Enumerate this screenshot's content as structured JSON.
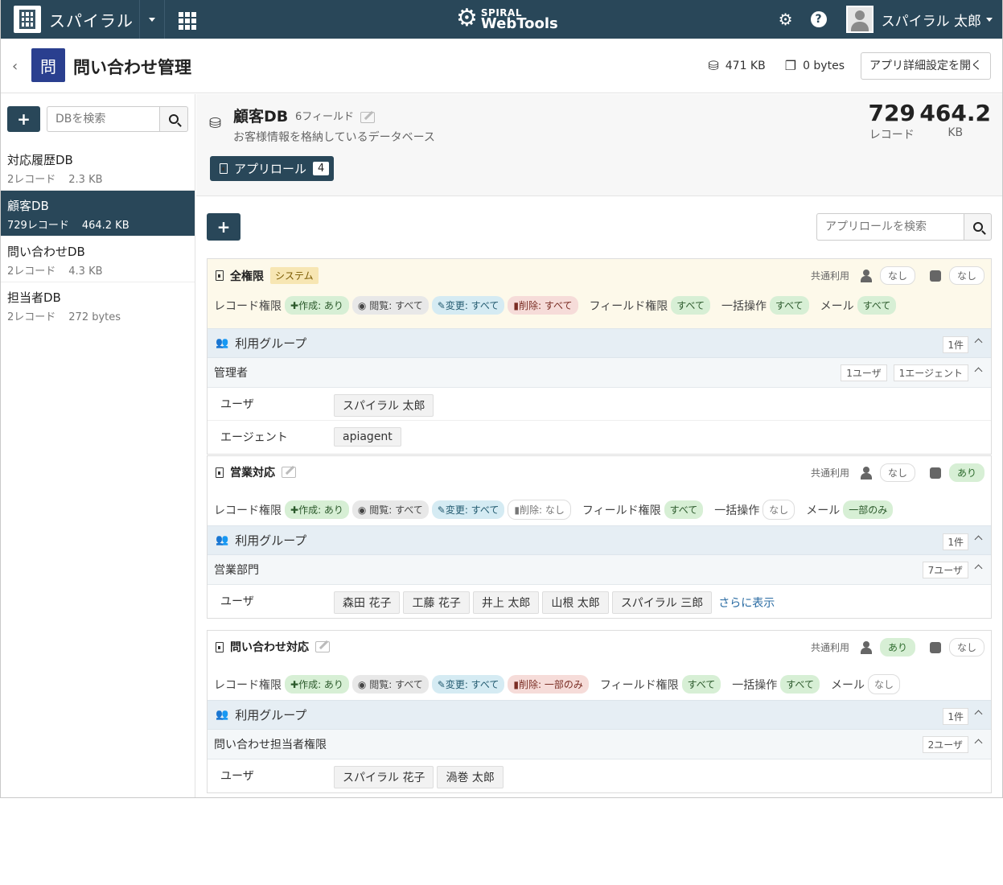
{
  "topnav": {
    "brand": "スパイラル",
    "logo_top": "SPIRAL",
    "logo_bottom": "WebTools",
    "user": "スパイラル 太郎"
  },
  "header": {
    "app_icon": "問",
    "title": "問い合わせ管理",
    "storage": "471 KB",
    "files": "0 bytes",
    "detail_button": "アプリ詳細設定を開く"
  },
  "sidebar": {
    "add": "+",
    "search_placeholder": "DBを検索",
    "items": [
      {
        "name": "対応履歴DB",
        "records": "2レコード",
        "size": "2.3 KB",
        "active": false
      },
      {
        "name": "顧客DB",
        "records": "729レコード",
        "size": "464.2 KB",
        "active": true
      },
      {
        "name": "問い合わせDB",
        "records": "2レコード",
        "size": "4.3 KB",
        "active": false
      },
      {
        "name": "担当者DB",
        "records": "2レコード",
        "size": "272 bytes",
        "active": false
      }
    ]
  },
  "db": {
    "name": "顧客DB",
    "fields": "6フィールド",
    "description": "お客様情報を格納しているデータベース",
    "role_button": "アプリロール",
    "role_count": "4",
    "records_value": "729",
    "records_label": "レコード",
    "size_value": "464.2",
    "size_label": "KB"
  },
  "roles_toolbar": {
    "add": "+",
    "search_placeholder": "アプリロールを検索"
  },
  "labels": {
    "shared": "共通利用",
    "record_perm": "レコード権限",
    "field_perm": "フィールド権限",
    "bulk": "一括操作",
    "mail": "メール",
    "group": "利用グループ",
    "user": "ユーザ",
    "agent": "エージェント",
    "more": "さらに表示"
  },
  "roles": [
    {
      "name": "全権限",
      "system_tag": "システム",
      "user_share": "なし",
      "agent_share": "なし",
      "create": "作成: あり",
      "view": "閲覧: すべて",
      "edit": "変更: すべて",
      "delete": "削除: すべて",
      "field": "すべて",
      "bulk": "すべて",
      "mail": "すべて",
      "group_count": "1件",
      "group_name": "管理者",
      "group_users": "1ユーザ",
      "group_agents": "1エージェント",
      "users": [
        "スパイラル 太郎"
      ],
      "agents": [
        "apiagent"
      ]
    },
    {
      "name": "営業対応",
      "user_share": "なし",
      "agent_share": "あり",
      "create": "作成: あり",
      "view": "閲覧: すべて",
      "edit": "変更: すべて",
      "delete": "削除: なし",
      "field": "すべて",
      "bulk": "なし",
      "mail": "一部のみ",
      "group_count": "1件",
      "group_name": "営業部門",
      "group_users": "7ユーザ",
      "users": [
        "森田 花子",
        "工藤 花子",
        "井上 太郎",
        "山根 太郎",
        "スパイラル 三郎"
      ]
    },
    {
      "name": "問い合わせ対応",
      "user_share": "あり",
      "agent_share": "なし",
      "create": "作成: あり",
      "view": "閲覧: すべて",
      "edit": "変更: すべて",
      "delete": "削除: 一部のみ",
      "field": "すべて",
      "bulk": "すべて",
      "mail": "なし",
      "group_count": "1件",
      "group_name": "問い合わせ担当者権限",
      "group_users": "2ユーザ",
      "users": [
        "スパイラル 花子",
        "渦巻 太郎"
      ]
    }
  ]
}
